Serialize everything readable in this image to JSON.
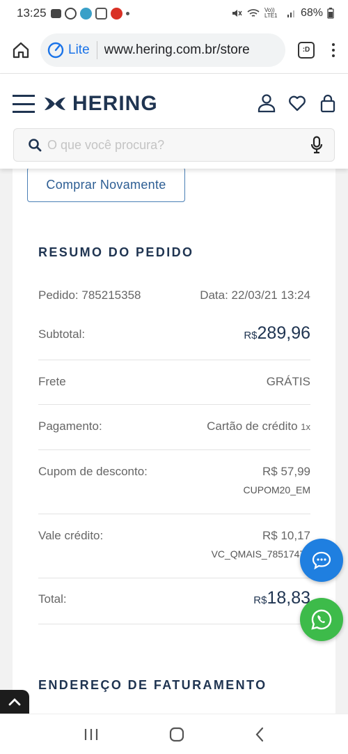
{
  "status_bar": {
    "time": "13:25",
    "battery": "68%",
    "network": "Vo)) LTE1"
  },
  "browser": {
    "lite_label": "Lite",
    "url": "www.hering.com.br/store",
    "tab_label": ":D"
  },
  "header": {
    "logo_text": "HERING",
    "search_placeholder": "O que você procura?"
  },
  "buy_again_label": "Comprar Novamente",
  "summary": {
    "title": "RESUMO DO PEDIDO",
    "order": "Pedido: 785215358",
    "date": "Data: 22/03/21 13:24",
    "subtotal_label": "Subtotal:",
    "currency": "R$",
    "subtotal_value": "289,96",
    "shipping_label": "Frete",
    "shipping_value": "GRÁTIS",
    "payment_label": "Pagamento:",
    "payment_value": "Cartão de crédito",
    "payment_installments": "1x",
    "coupon_label": "Cupom de desconto:",
    "coupon_value": "R$ 57,99",
    "coupon_code": "CUPOM20_EM",
    "credit_label": "Vale crédito:",
    "credit_value": "R$ 10,17",
    "credit_code": "VC_QMAIS_78517476",
    "total_label": "Total:",
    "total_value": "18,83"
  },
  "billing_title": "ENDEREÇO DE FATURAMENTO"
}
